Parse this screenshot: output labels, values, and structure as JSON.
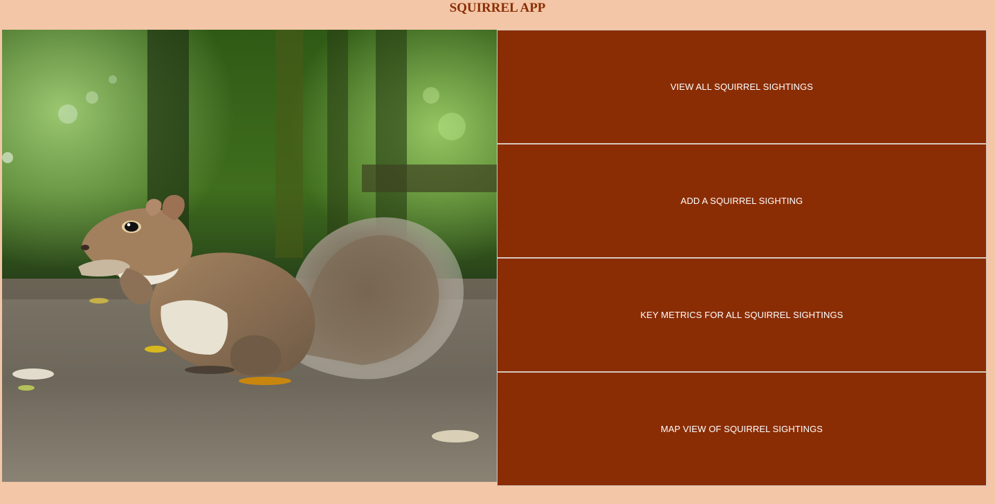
{
  "app": {
    "title": "SQUIRREL APP"
  },
  "hero": {
    "image": "squirrel-photo",
    "subject": "grey squirrel eating on a forest path"
  },
  "menu": {
    "items": [
      {
        "label": "VIEW ALL SQUIRREL SIGHTINGS",
        "icon": "none"
      },
      {
        "label": "ADD A SQUIRREL SIGHTING",
        "icon": "none"
      },
      {
        "label": "KEY METRICS FOR ALL SQUIRREL SIGHTINGS",
        "icon": "none"
      },
      {
        "label": "MAP VIEW OF SQUIRREL SIGHTINGS",
        "icon": "none"
      }
    ]
  },
  "colors": {
    "page_background": "#f2c6a7",
    "accent": "#8a2d04",
    "button_text": "#ffffff",
    "divider": "#d7c8bd"
  }
}
